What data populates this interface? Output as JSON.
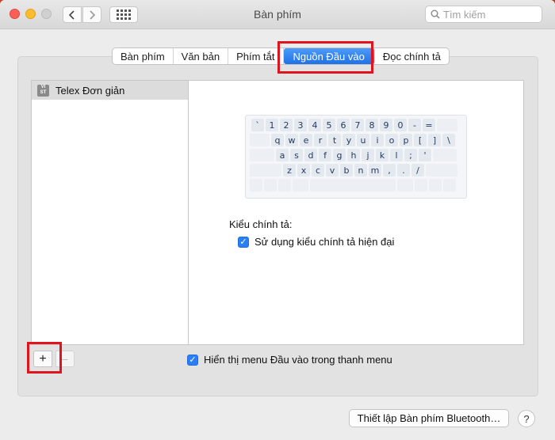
{
  "window": {
    "title": "Bàn phím"
  },
  "search": {
    "placeholder": "Tìm kiếm"
  },
  "tabs": [
    {
      "label": "Bàn phím",
      "active": false
    },
    {
      "label": "Văn bản",
      "active": false
    },
    {
      "label": "Phím tắt",
      "active": false
    },
    {
      "label": "Nguồn Đầu vào",
      "active": true
    },
    {
      "label": "Đọc chính tả",
      "active": false
    }
  ],
  "input_sources": [
    {
      "badge_top": "VI",
      "badge_bottom": "ST",
      "label": "Telex Đơn giản",
      "selected": true
    }
  ],
  "keyboard_rows": [
    [
      "`",
      "1",
      "2",
      "3",
      "4",
      "5",
      "6",
      "7",
      "8",
      "9",
      "0",
      "-",
      "="
    ],
    [
      "q",
      "w",
      "e",
      "r",
      "t",
      "y",
      "u",
      "i",
      "o",
      "p",
      "[",
      "]",
      "\\"
    ],
    [
      "a",
      "s",
      "d",
      "f",
      "g",
      "h",
      "j",
      "k",
      "l",
      ";",
      "'"
    ],
    [
      "z",
      "x",
      "c",
      "v",
      "b",
      "n",
      "m",
      ",",
      ".",
      "/"
    ]
  ],
  "spelling": {
    "section_label": "Kiểu chính tả:",
    "modern_label": "Sử dụng kiểu chính tả hiện đại",
    "modern_checked": true
  },
  "show_menu": {
    "label": "Hiển thị menu Đầu vào trong thanh menu",
    "checked": true
  },
  "buttons": {
    "add": "+",
    "remove": "−",
    "bluetooth": "Thiết lập Bàn phím Bluetooth…",
    "help": "?"
  },
  "colors": {
    "accent": "#1f71e6",
    "highlight": "#e0141e"
  }
}
